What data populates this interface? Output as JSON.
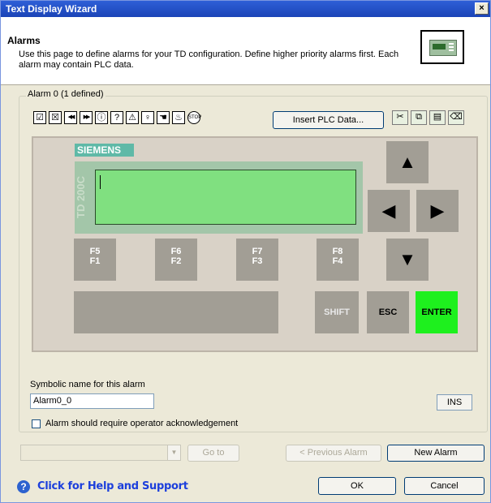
{
  "window": {
    "title": "Text Display Wizard",
    "close_glyph": "×"
  },
  "header": {
    "title": "Alarms",
    "description": "Use this page to define alarms for your TD configuration. Define higher priority alarms first. Each alarm may contain PLC data.",
    "icon": "td-device-icon"
  },
  "group": {
    "label": "Alarm 0 (1 defined)"
  },
  "toolbar": {
    "symbols": [
      {
        "name": "check-box-icon",
        "glyph": "☑"
      },
      {
        "name": "x-box-icon",
        "glyph": "☒"
      },
      {
        "name": "rewind-icon",
        "glyph": "◀◀"
      },
      {
        "name": "fast-forward-icon",
        "glyph": "▶▶"
      },
      {
        "name": "info-icon",
        "glyph": "ⓘ"
      },
      {
        "name": "question-icon",
        "glyph": "?"
      },
      {
        "name": "warning-icon",
        "glyph": "⚠"
      },
      {
        "name": "bulb-icon",
        "glyph": "♀"
      },
      {
        "name": "hand-icon",
        "glyph": "☚"
      },
      {
        "name": "fire-icon",
        "glyph": "♨"
      },
      {
        "name": "stop-icon",
        "glyph": "STOP"
      }
    ],
    "insert_plc_label": "Insert PLC Data...",
    "edit_tools": [
      {
        "name": "cut-icon",
        "glyph": "✂"
      },
      {
        "name": "copy-icon",
        "glyph": "⧉"
      },
      {
        "name": "paste-icon",
        "glyph": "▤"
      },
      {
        "name": "delete-icon",
        "glyph": "⌫"
      }
    ]
  },
  "device": {
    "brand": "SIEMENS",
    "model": "TD 200C",
    "display_text": "",
    "fkeys": [
      {
        "top": "F5",
        "bottom": "F1"
      },
      {
        "top": "F6",
        "bottom": "F2"
      },
      {
        "top": "F7",
        "bottom": "F3"
      },
      {
        "top": "F8",
        "bottom": "F4"
      }
    ],
    "arrows": {
      "up": "▲",
      "left": "◀",
      "right": "▶",
      "down": "▼"
    },
    "shift_label": "SHIFT",
    "esc_label": "ESC",
    "enter_label": "ENTER",
    "enter_color": "#1ef01e"
  },
  "symbolic": {
    "label": "Symbolic name for this alarm",
    "value": "Alarm0_0"
  },
  "ins_label": "INS",
  "acknowledge": {
    "label": "Alarm should require operator acknowledgement",
    "checked": false
  },
  "nav": {
    "combo_value": "",
    "goto_label": "Go to",
    "prev_label": "< Previous Alarm",
    "new_label": "New Alarm"
  },
  "help": {
    "text": "Click for Help and Support",
    "glyph": "?"
  },
  "footer": {
    "ok_label": "OK",
    "cancel_label": "Cancel"
  }
}
